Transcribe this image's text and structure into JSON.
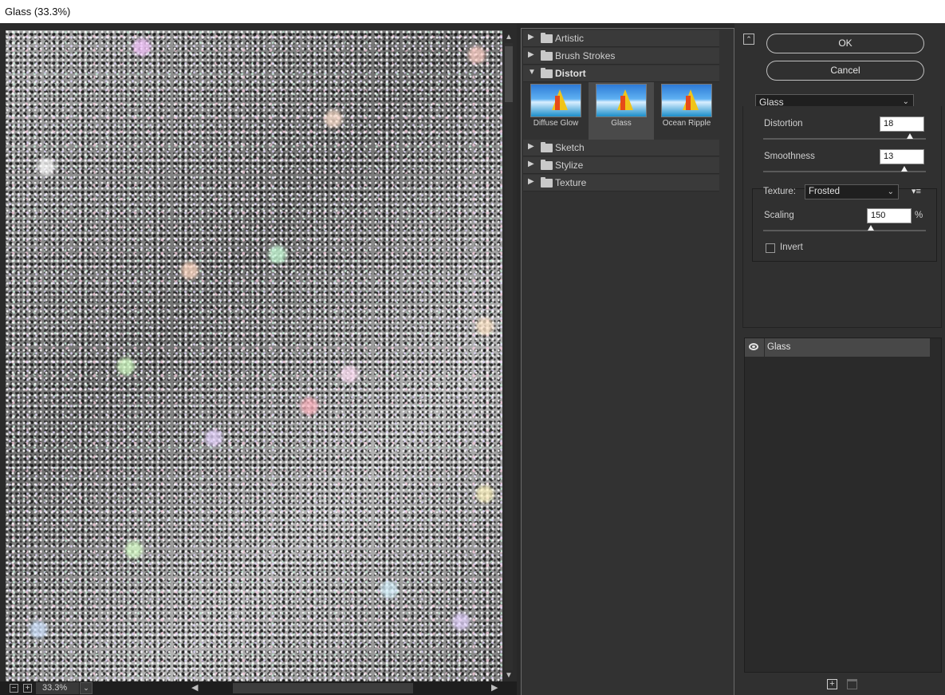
{
  "window": {
    "title": "Glass (33.3%)"
  },
  "preview": {
    "zoom": "33.3%",
    "zoom_out_glyph": "−",
    "zoom_in_glyph": "+",
    "dropdown_glyph": "⌄",
    "scroll_up_glyph": "▲",
    "scroll_down_glyph": "▼",
    "scroll_left_glyph": "◀",
    "scroll_right_glyph": "▶"
  },
  "gallery": {
    "categories": [
      {
        "label": "Artistic",
        "expanded": false,
        "glyph": "▶"
      },
      {
        "label": "Brush Strokes",
        "expanded": false,
        "glyph": "▶"
      },
      {
        "label": "Distort",
        "expanded": true,
        "glyph": "▼"
      },
      {
        "label": "Sketch",
        "expanded": false,
        "glyph": "▶"
      },
      {
        "label": "Stylize",
        "expanded": false,
        "glyph": "▶"
      },
      {
        "label": "Texture",
        "expanded": false,
        "glyph": "▶"
      }
    ],
    "filters": [
      {
        "label": "Diffuse Glow",
        "selected": false
      },
      {
        "label": "Glass",
        "selected": true
      },
      {
        "label": "Ocean Ripple",
        "selected": false
      }
    ]
  },
  "panel": {
    "collapse_glyph": "⌃",
    "ok_label": "OK",
    "cancel_label": "Cancel",
    "filter_select": "Glass",
    "chevron": "⌄",
    "distortion": {
      "label": "Distortion",
      "value": "18",
      "level_fraction": 0.9
    },
    "smoothness": {
      "label": "Smoothness",
      "value": "13",
      "level_fraction": 0.87
    },
    "texture": {
      "label": "Texture:",
      "value": "Frosted",
      "menu_glyph": "▾≡"
    },
    "scaling": {
      "label": "Scaling",
      "value": "150",
      "unit": "%",
      "level_fraction": 0.66
    },
    "invert": {
      "label": "Invert",
      "checked": false
    }
  },
  "layers": {
    "items": [
      {
        "name": "Glass",
        "visible": true
      }
    ],
    "new_glyph": "+"
  },
  "colors": {
    "background": "#282828",
    "panel": "#303030",
    "selected_tile": "#4a4a4a",
    "layer_row": "#484848"
  }
}
